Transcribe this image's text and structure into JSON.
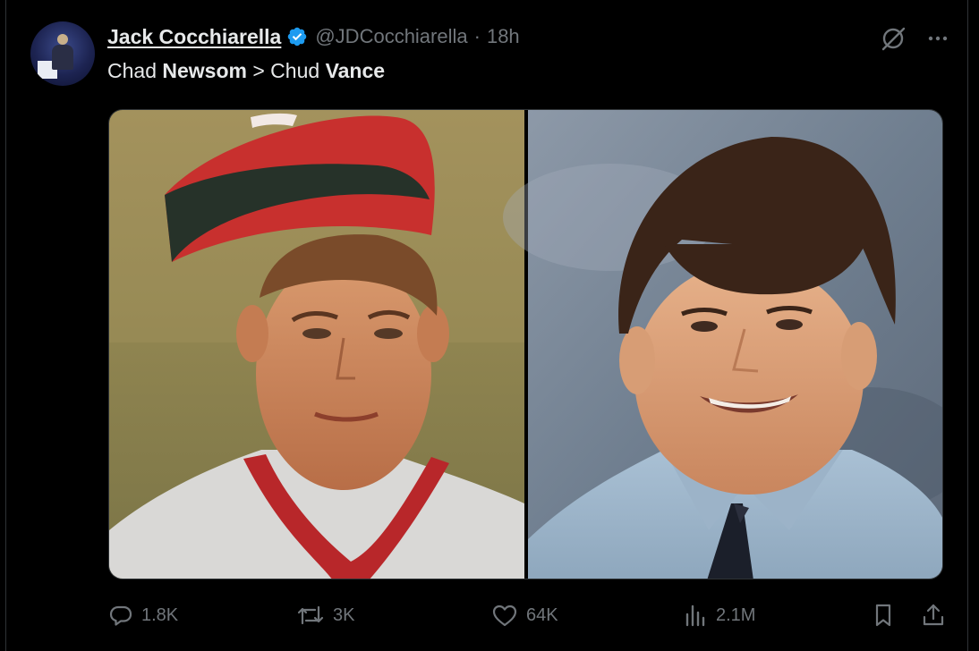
{
  "author": {
    "display_name": "Jack Cocchiarella",
    "handle": "@JDCocchiarella",
    "separator": "·",
    "timestamp": "18h",
    "verified_color": "#1d9bf0"
  },
  "tweet": {
    "text_parts": {
      "p1": "Chad ",
      "p2": "Newsom",
      "p3": " > Chud ",
      "p4": "Vance"
    }
  },
  "media": {
    "layout": "two-photo-grid",
    "left_photo_icon": "baseball-player-portrait",
    "right_photo_icon": "yearbook-portrait"
  },
  "actions": {
    "reply_count": "1.8K",
    "retweet_count": "3K",
    "like_count": "64K",
    "views_count": "2.1M"
  },
  "colors": {
    "background": "#000000",
    "text_primary": "#e7e9ea",
    "text_secondary": "#71767b",
    "border": "#2f3336"
  }
}
